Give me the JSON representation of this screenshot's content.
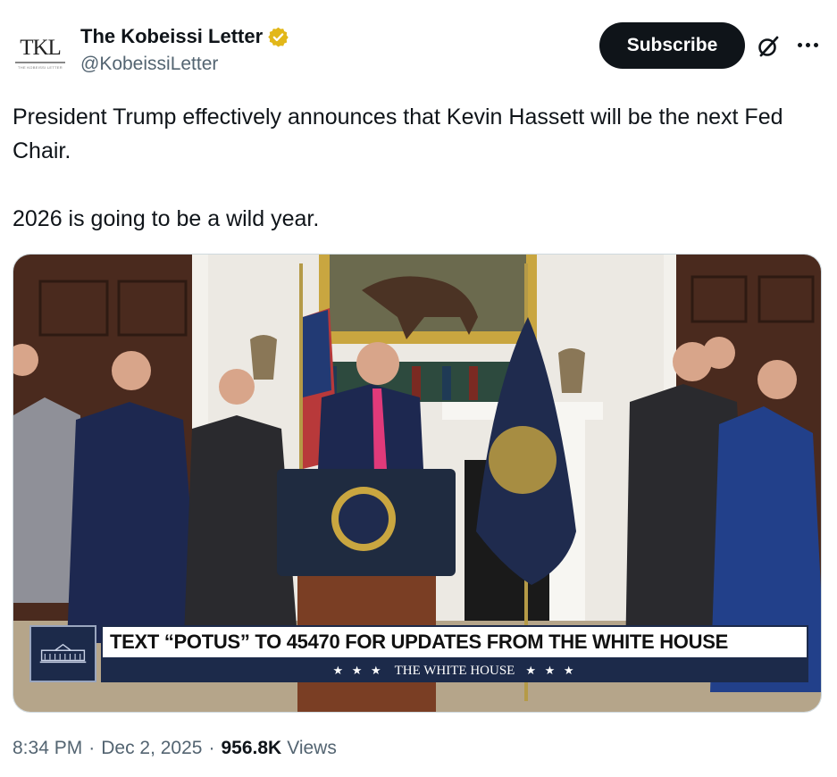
{
  "author": {
    "avatar_text": "TKL",
    "avatar_subtext": "THE KOBEISSI LETTER",
    "display_name": "The Kobeissi Letter",
    "handle": "@KobeissiLetter",
    "verified_icon": "verified-badge-gold",
    "verified_color": "#e2b719"
  },
  "actions": {
    "subscribe_label": "Subscribe",
    "grok_icon": "grok-icon",
    "more_icon": "more-icon"
  },
  "tweet": {
    "paragraph_1": "President Trump effectively announces that Kevin Hassett will be the next Fed Chair.",
    "paragraph_2": "2026 is going to be a wild year."
  },
  "media": {
    "lower_third_main": "TEXT “POTUS” TO 45470 FOR UPDATES FROM THE WHITE HOUSE",
    "lower_third_sub": "THE WHITE HOUSE",
    "lower_third_stars": "★ ★ ★",
    "lower_third_color": "#1c2a4a"
  },
  "meta": {
    "time": "8:34 PM",
    "separator": "·",
    "date": "Dec 2, 2025",
    "views_count": "956.8K",
    "views_label": "Views"
  },
  "colors": {
    "text_primary": "#0f1419",
    "text_secondary": "#536471",
    "button_dark": "#0f1419"
  }
}
